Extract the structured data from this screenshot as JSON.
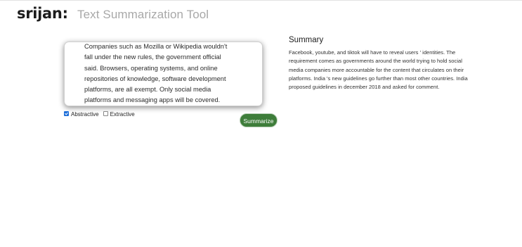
{
  "header": {
    "brand": "srijan:",
    "title": "Text Summarization Tool"
  },
  "input": {
    "text": "Companies such as Mozilla or Wikipedia wouldn't\nfall under the new rules, the government official\nsaid. Browsers, operating systems, and online\nrepositories of knowledge, software development\nplatforms, are all exempt. Only social media\nplatforms and messaging apps will be covered."
  },
  "options": [
    {
      "label": "Abstractive",
      "checked": true
    },
    {
      "label": "Extractive",
      "checked": false
    }
  ],
  "actions": {
    "summarize_label": "Summarize"
  },
  "summary": {
    "heading": "Summary",
    "text": "Facebook, youtube, and tiktok will have to reveal users ' identities. The\nrequirement comes as governments around the world trying to hold social\nmedia companies more accountable for the content that circulates on their\nplatforms. India 's new guidelines go further than most other countries. India\nproposed guidelines in december 2018 and asked for comment."
  },
  "colors": {
    "brand_text": "#1c1c1c",
    "title_text": "#a8a8a8",
    "button_bg": "#3e7d3a",
    "checkbox_checked": "#1e6fd9"
  }
}
